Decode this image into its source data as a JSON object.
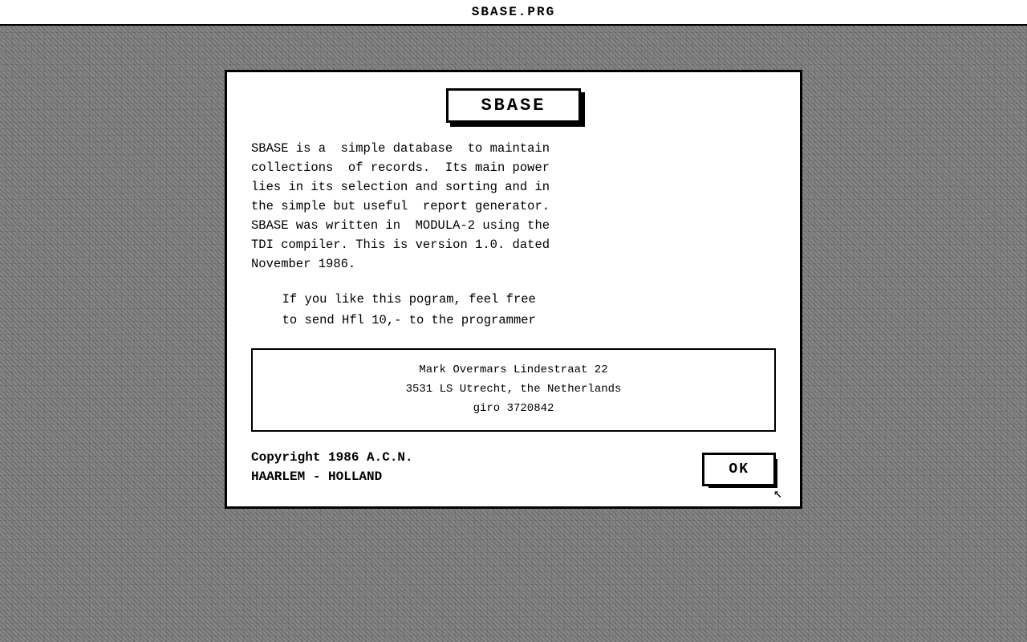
{
  "titleBar": {
    "text": "SBASE.PRG"
  },
  "dialog": {
    "appTitle": "SBASE",
    "descriptionText": "SBASE is a  simple database  to maintain\ncollections  of records.  Its main power\nlies in its selection and sorting and in\nthe simple but useful  report generator.\nSBASE was written in  MODULA-2 using the\nTDI compiler. This is version 1.0. dated\nNovember 1986.",
    "inviteText": "  If you like this pogram, feel free\n  to send Hfl 10,- to the programmer",
    "address": {
      "line1": "Mark Overmars         Lindestraat 22",
      "line2": "3531 LS Utrecht, the Netherlands",
      "line3": "giro 3720842"
    },
    "copyright": {
      "line1": "Copyright 1986 A.C.N.",
      "line2": "HAARLEM - HOLLAND"
    },
    "okButton": "OK"
  }
}
